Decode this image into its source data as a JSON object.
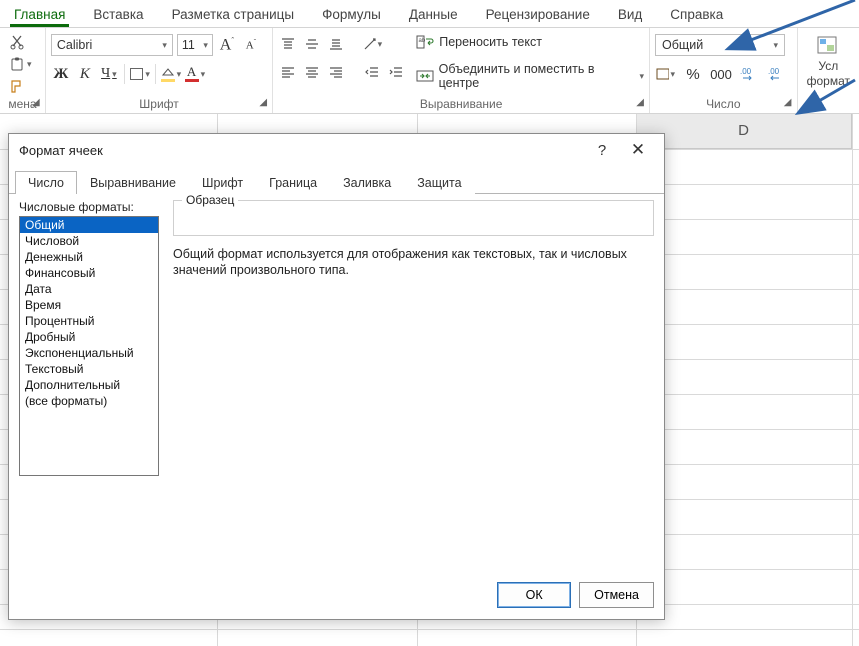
{
  "ribbon": {
    "tabs": [
      "Главная",
      "Вставка",
      "Разметка страницы",
      "Формулы",
      "Данные",
      "Рецензирование",
      "Вид",
      "Справка"
    ],
    "active_tab_index": 0,
    "clipboard": {
      "label": "мена"
    },
    "font": {
      "name": "Calibri",
      "size": "11",
      "group_label": "Шрифт"
    },
    "alignment": {
      "wrap_label": "Переносить текст",
      "merge_label": "Объединить и поместить в центре",
      "group_label": "Выравнивание"
    },
    "number": {
      "format_selected": "Общий",
      "group_label": "Число"
    },
    "styles": {
      "label1": "Усл",
      "label2": "формат"
    }
  },
  "sheet": {
    "col_D": "D"
  },
  "dialog": {
    "title": "Формат ячеек",
    "help": "?",
    "close": "✕",
    "tabs": [
      "Число",
      "Выравнивание",
      "Шрифт",
      "Граница",
      "Заливка",
      "Защита"
    ],
    "active_tab_index": 0,
    "categories_label": "Числовые форматы:",
    "categories": [
      "Общий",
      "Числовой",
      "Денежный",
      "Финансовый",
      "Дата",
      "Время",
      "Процентный",
      "Дробный",
      "Экспоненциальный",
      "Текстовый",
      "Дополнительный",
      "(все форматы)"
    ],
    "selected_category_index": 0,
    "sample_label": "Образец",
    "description": "Общий формат используется для отображения как текстовых, так и числовых значений произвольного типа.",
    "ok": "ОК",
    "cancel": "Отмена"
  }
}
